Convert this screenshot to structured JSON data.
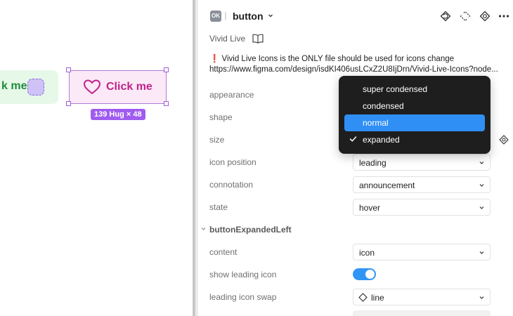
{
  "canvas": {
    "left_variant": {
      "label": "k me"
    },
    "selected_button": {
      "label": "Click me",
      "size_badge": "139 Hug × 48"
    }
  },
  "header": {
    "component_icon_text": "OK",
    "component_name": "button",
    "icons": [
      "reset-instance-icon",
      "detach-icon",
      "go-to-main-icon",
      "more-icon"
    ]
  },
  "library": {
    "name": "Vivid Live",
    "icon": "book-icon"
  },
  "notice": {
    "text": "❗ Vivid Live Icons is the ONLY file should be used for icons change",
    "url": "https://www.figma.com/design/isdKI406usLCxZ2U8IjDrn/Vivid-Live-Icons?node..."
  },
  "properties": [
    {
      "label": "appearance"
    },
    {
      "label": "shape"
    },
    {
      "label": "size"
    },
    {
      "label": "icon position",
      "value": "leading"
    },
    {
      "label": "connotation",
      "value": "announcement"
    },
    {
      "label": "state",
      "value": "hover"
    }
  ],
  "section": {
    "title": "buttonExpandedLeft",
    "properties": [
      {
        "label": "content",
        "value": "icon"
      },
      {
        "label": "show leading icon",
        "toggle": true
      },
      {
        "label": "leading icon swap",
        "value": "line",
        "icon": "diamond-icon"
      }
    ]
  },
  "size_dropdown": {
    "options": [
      "super condensed",
      "condensed",
      "normal",
      "expanded"
    ],
    "highlighted": "normal",
    "checked": "expanded"
  },
  "colors": {
    "accent": "#2f8ff5",
    "toggle_on": "#3096f5",
    "selection": "#a05cf0",
    "button_text": "#c0238a",
    "button_bg": "#fbe9f7",
    "variant_green_text": "#1f8a3b",
    "variant_green_bg": "#e6f8e8"
  }
}
